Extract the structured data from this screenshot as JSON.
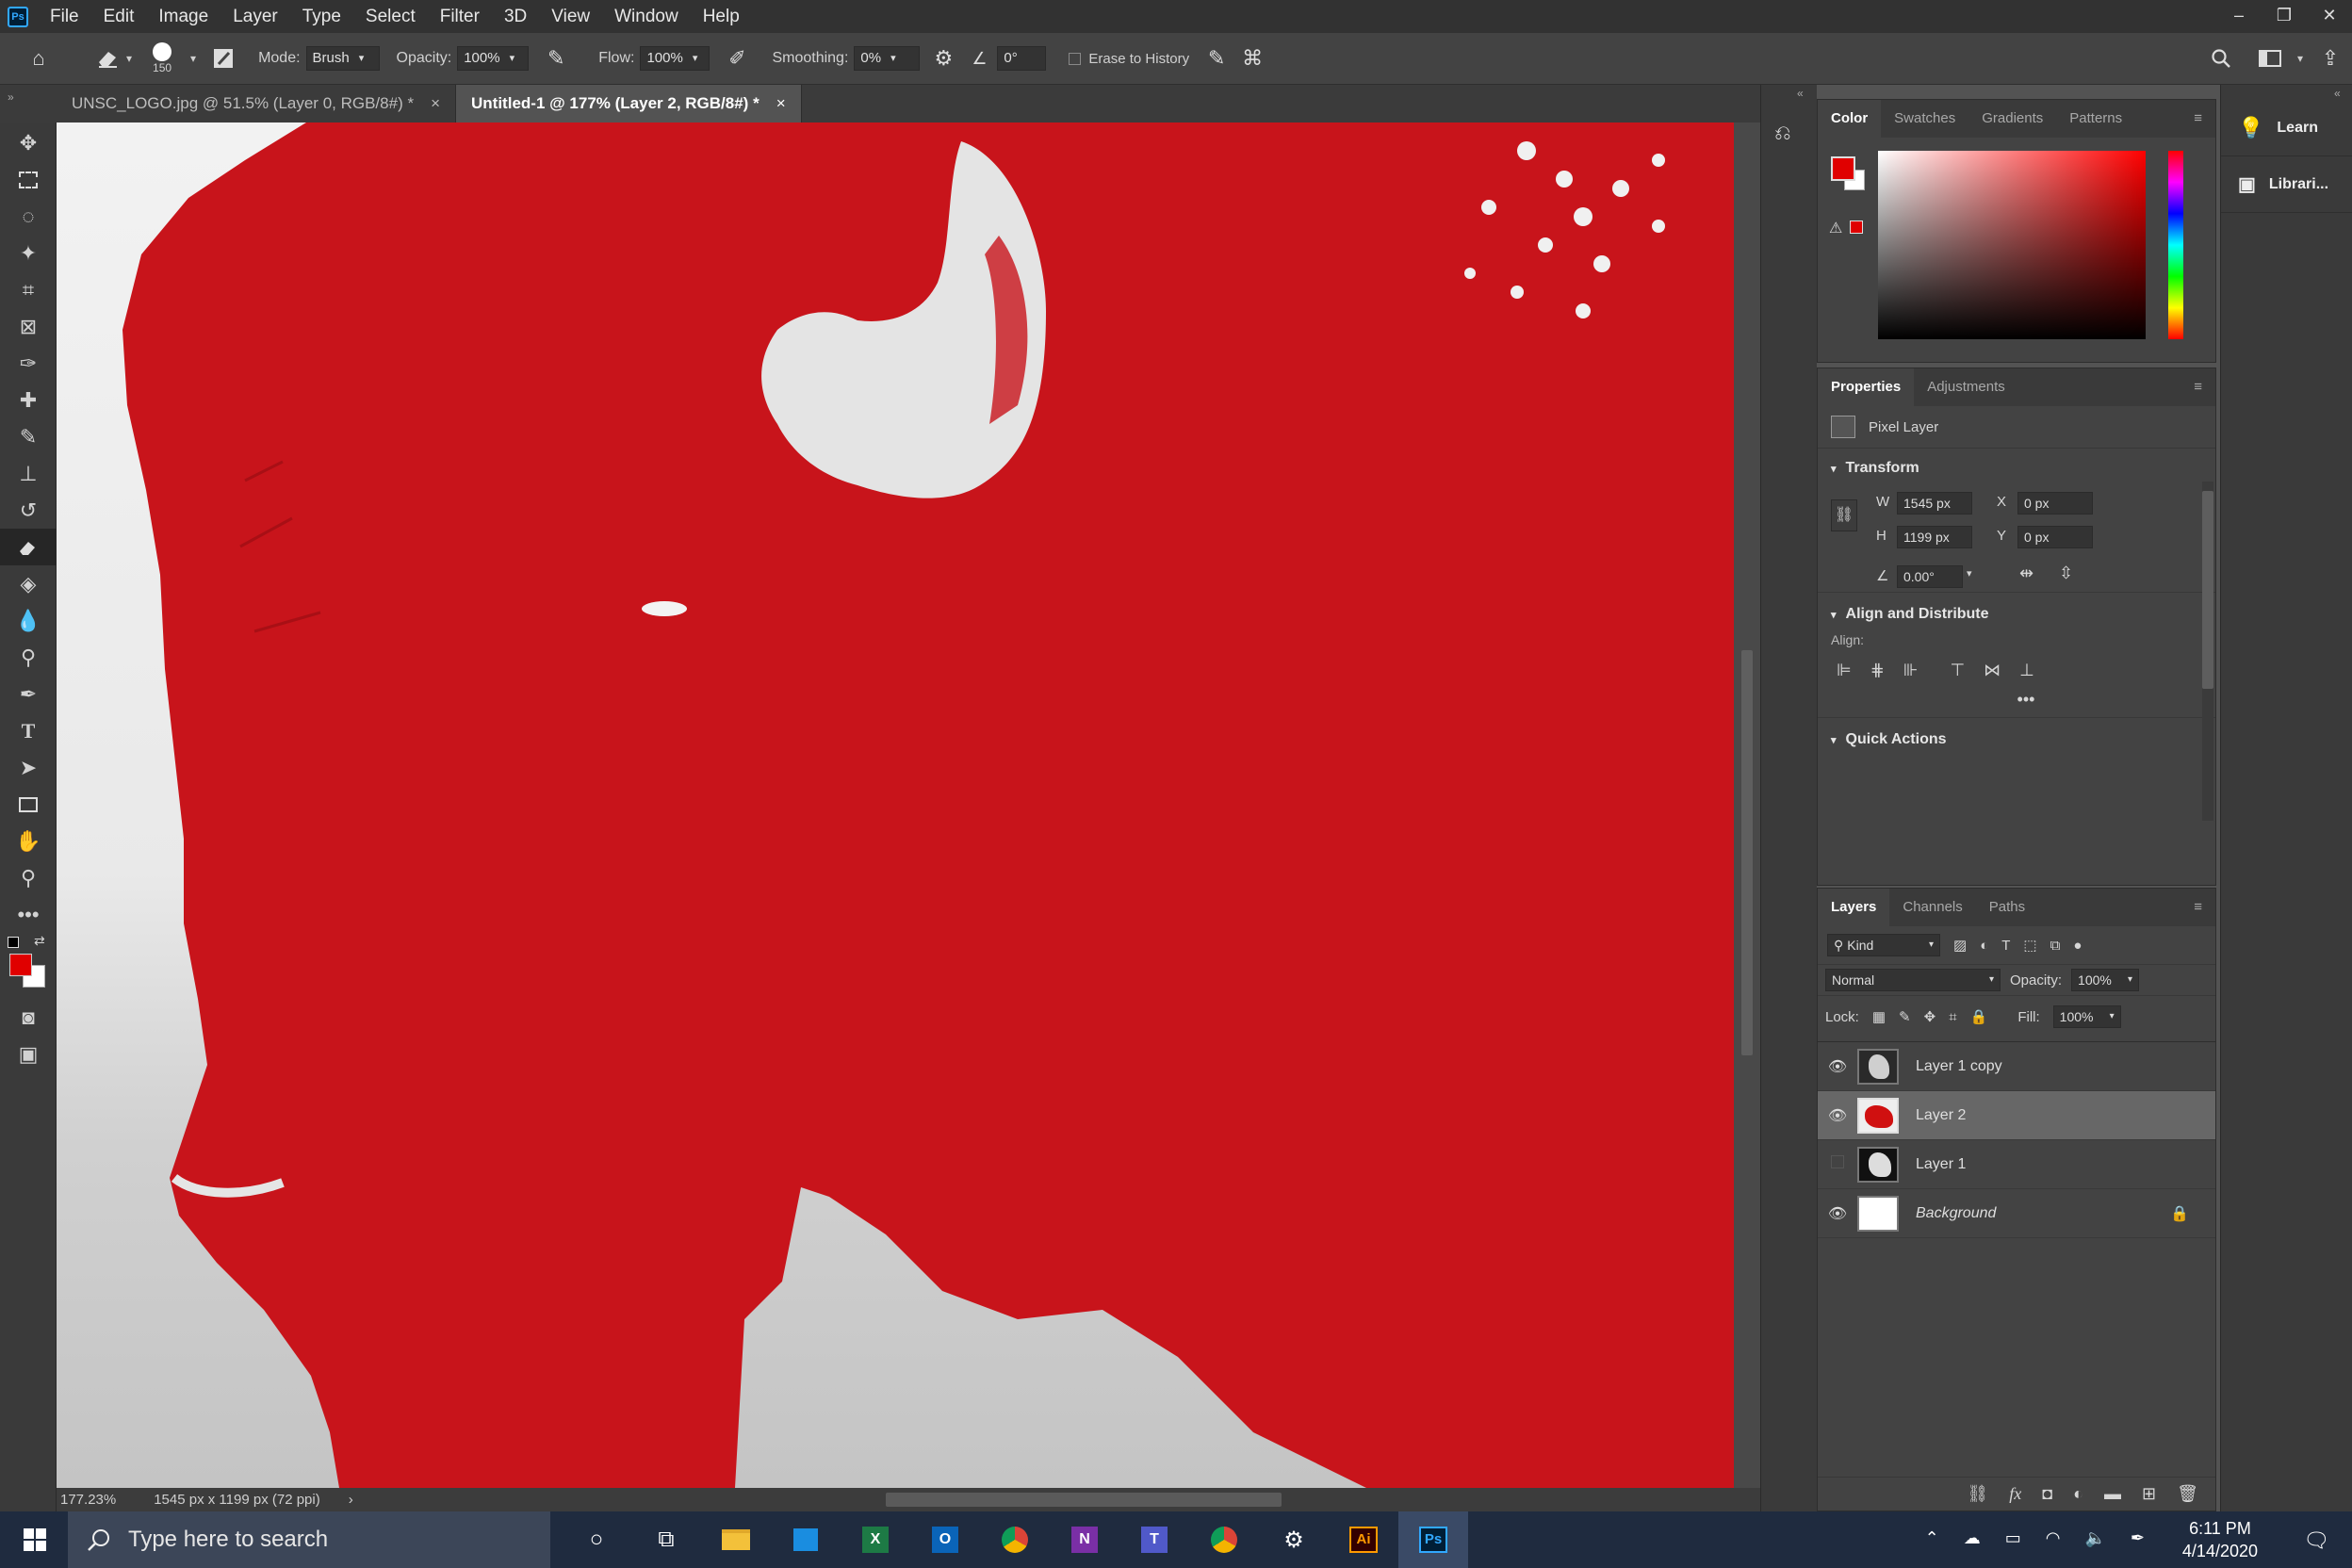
{
  "menu": [
    "File",
    "Edit",
    "Image",
    "Layer",
    "Type",
    "Select",
    "Filter",
    "3D",
    "View",
    "Window",
    "Help"
  ],
  "options": {
    "brush_size": "150",
    "mode_label": "Mode:",
    "mode_value": "Brush",
    "opacity_label": "Opacity:",
    "opacity_value": "100%",
    "flow_label": "Flow:",
    "flow_value": "100%",
    "smoothing_label": "Smoothing:",
    "smoothing_value": "0%",
    "angle_value": "0°",
    "erase_history": "Erase to History"
  },
  "doc_tabs": [
    {
      "label": "UNSC_LOGO.jpg @ 51.5% (Layer 0, RGB/8#) *"
    },
    {
      "label": "Untitled-1 @ 177% (Layer 2, RGB/8#) *"
    }
  ],
  "status": {
    "zoom": "177.23%",
    "doc_info": "1545 px x 1199 px (72 ppi)"
  },
  "color_panel": {
    "tabs": [
      "Color",
      "Swatches",
      "Gradients",
      "Patterns"
    ],
    "foreground": "#e00000",
    "background": "#ffffff"
  },
  "properties": {
    "tabs": [
      "Properties",
      "Adjustments"
    ],
    "type": "Pixel Layer",
    "transform_title": "Transform",
    "w_label": "W",
    "w": "1545 px",
    "h_label": "H",
    "h": "1199 px",
    "x_label": "X",
    "x": "0 px",
    "y_label": "Y",
    "y": "0 px",
    "angle": "0.00°",
    "align_title": "Align and Distribute",
    "align_label": "Align:",
    "quick_title": "Quick Actions"
  },
  "layers_panel": {
    "tabs": [
      "Layers",
      "Channels",
      "Paths"
    ],
    "kind": "Kind",
    "blend": "Normal",
    "opacity_label": "Opacity:",
    "opacity": "100%",
    "lock_label": "Lock:",
    "fill_label": "Fill:",
    "fill": "100%",
    "layers": [
      {
        "name": "Layer 1 copy",
        "visible": true
      },
      {
        "name": "Layer 2",
        "visible": true,
        "selected": true
      },
      {
        "name": "Layer 1",
        "visible": false
      },
      {
        "name": "Background",
        "visible": true,
        "locked": true
      }
    ]
  },
  "right_strip": [
    {
      "label": "Learn"
    },
    {
      "label": "Librari..."
    }
  ],
  "taskbar": {
    "search_placeholder": "Type here to search",
    "time": "6:11 PM",
    "date": "4/14/2020"
  }
}
